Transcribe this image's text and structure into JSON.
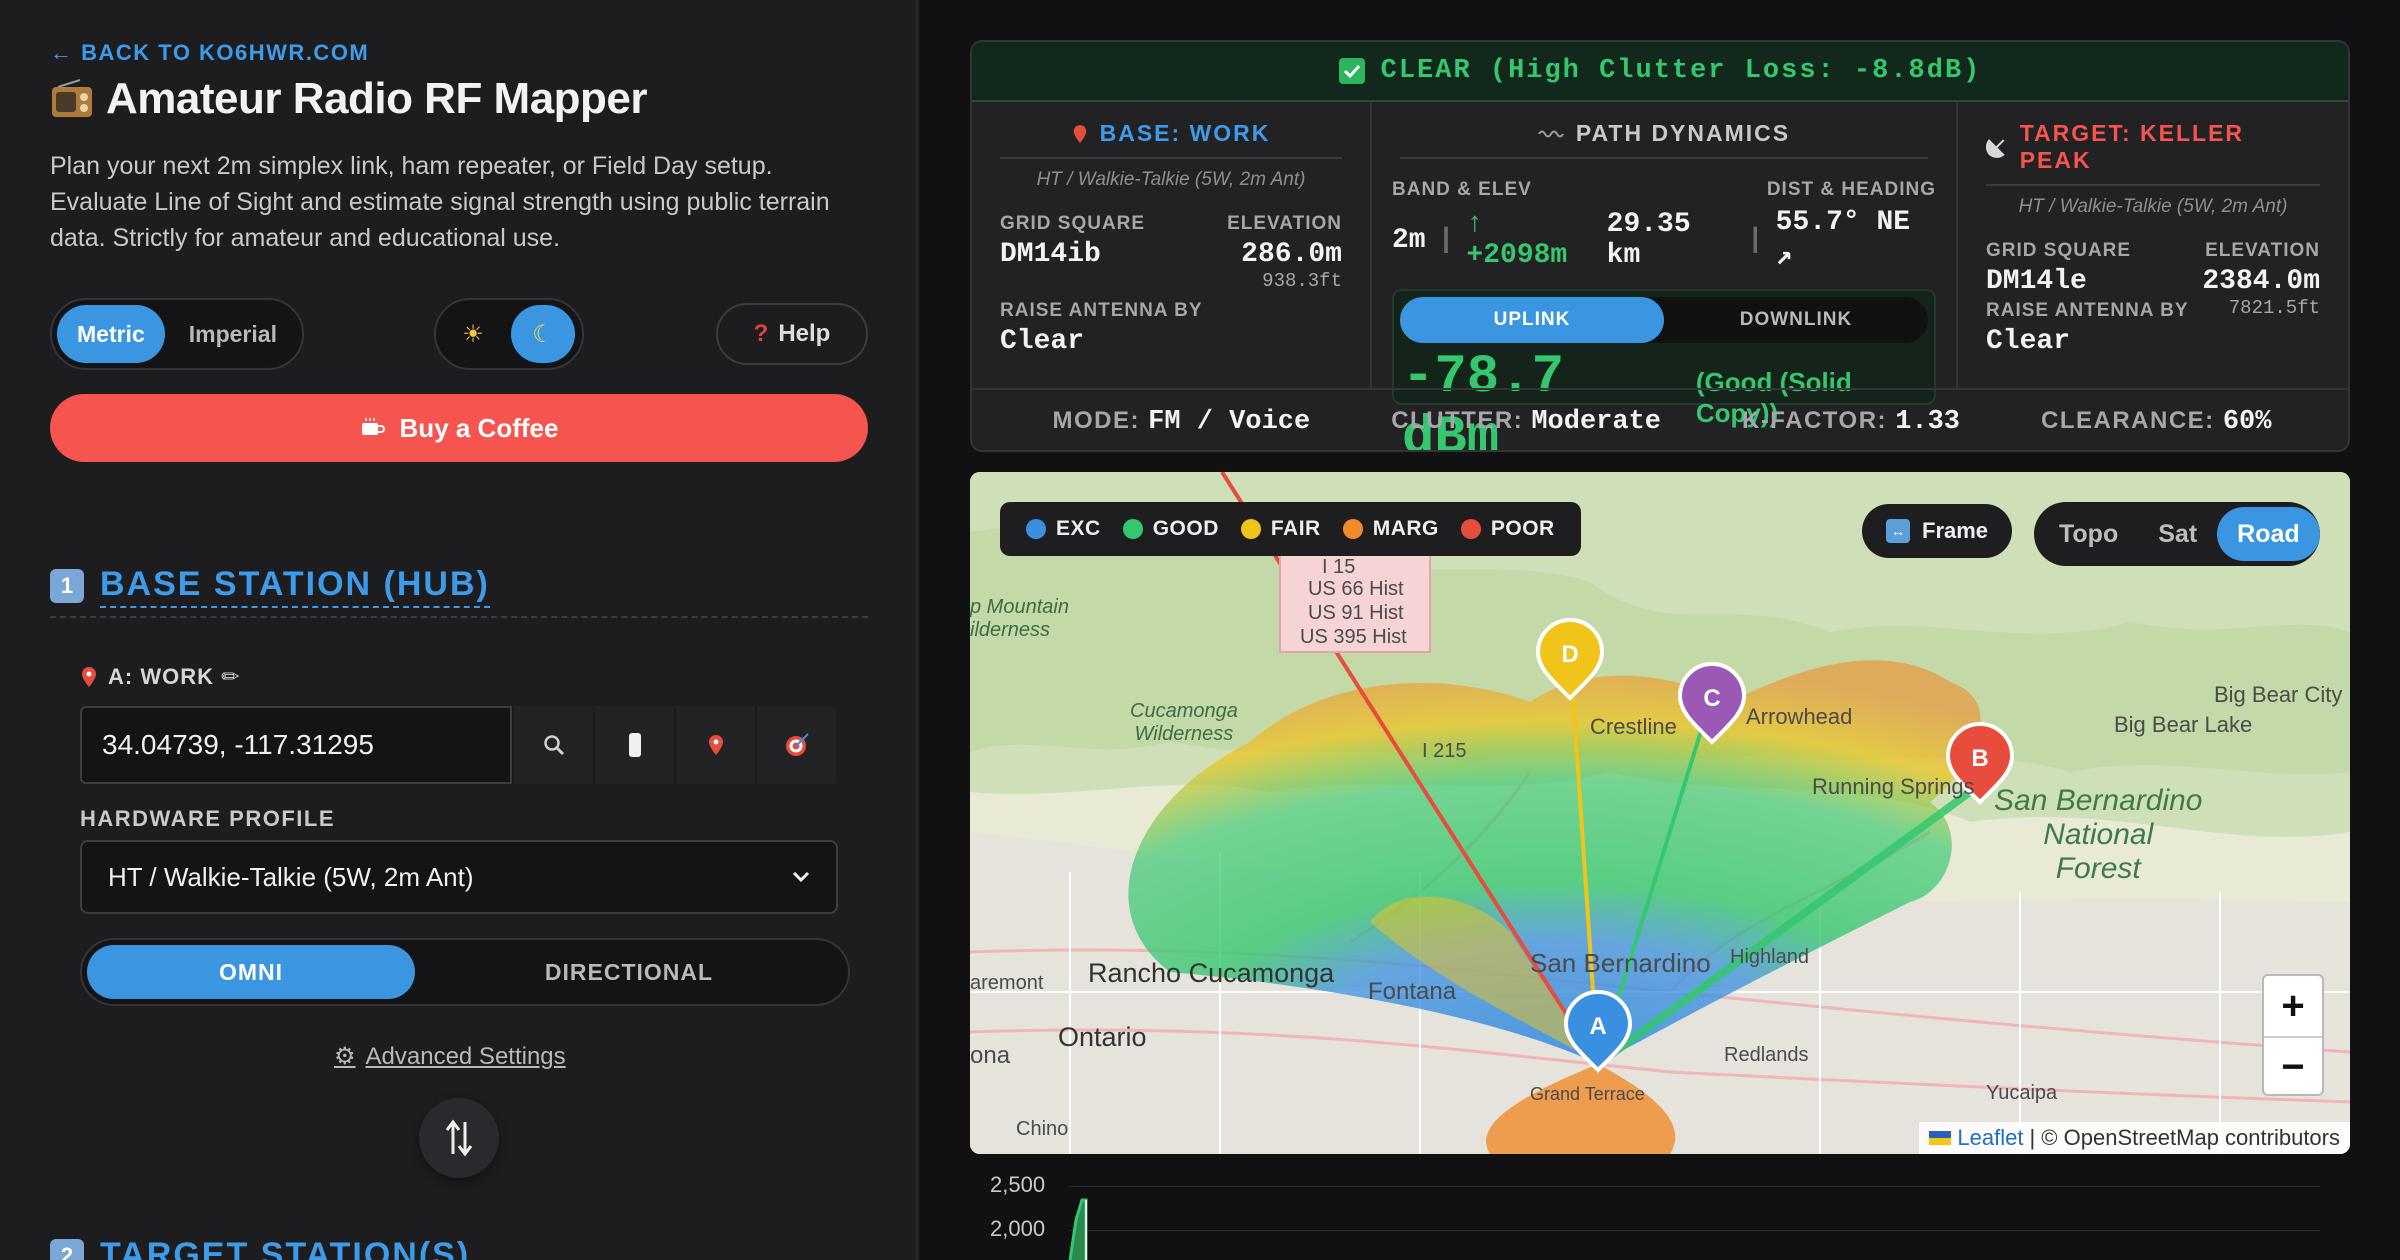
{
  "sidebar": {
    "back_link": "← BACK TO KO6HWR.COM",
    "title": "Amateur Radio RF Mapper",
    "intro": "Plan your next 2m simplex link, ham repeater, or Field Day setup. Evaluate Line of Sight and estimate signal strength using public terrain data. Strictly for amateur and educational use.",
    "units": {
      "metric": "Metric",
      "imperial": "Imperial",
      "selected": "Metric"
    },
    "theme": {
      "sun": "☀",
      "moon": "☾",
      "selected": "dark"
    },
    "help_label": "Help",
    "help_icon": "?",
    "coffee_label": "Buy a Coffee",
    "section1": {
      "number": "1",
      "label": "BASE STATION (HUB)"
    },
    "station_a": {
      "label": "A: WORK ✏",
      "coords": "34.04739, -117.31295",
      "hardware_label": "HARDWARE PROFILE",
      "hardware_value": "HT / Walkie-Talkie (5W, 2m Ant)",
      "mode_omni": "OMNI",
      "mode_directional": "DIRECTIONAL",
      "mode_selected": "OMNI"
    },
    "advanced_label": "Advanced Settings",
    "section2": {
      "number": "2",
      "label": "TARGET STATION(S)"
    }
  },
  "result": {
    "status": "CLEAR (High Clutter Loss: -8.8dB)",
    "base": {
      "header": "BASE: WORK",
      "profile": "HT / Walkie-Talkie (5W, 2m Ant)",
      "grid_label": "GRID SQUARE",
      "grid": "DM14ib",
      "elev_label": "ELEVATION",
      "elev": "286.0m",
      "elev_ft": "938.3ft",
      "raise_label": "RAISE ANTENNA BY",
      "raise": "Clear"
    },
    "path": {
      "header": "PATH DYNAMICS",
      "band_label": "BAND & ELEV",
      "dist_label": "DIST & HEADING",
      "band": "2m",
      "sep": "|",
      "elev_gain": "↑ +2098m",
      "dist": "29.35 km",
      "heading": "55.7° NE ↗",
      "uplink": "UPLINK",
      "downlink": "DOWNLINK",
      "link_selected": "UPLINK",
      "signal": "-78.7 dBm",
      "quality": "(Good (Solid Copy))"
    },
    "target": {
      "header": "TARGET: KELLER PEAK",
      "profile": "HT / Walkie-Talkie (5W, 2m Ant)",
      "grid_label": "GRID SQUARE",
      "grid": "DM14le",
      "elev_label": "ELEVATION",
      "elev": "2384.0m",
      "elev_ft": "7821.5ft",
      "raise_label": "RAISE ANTENNA BY",
      "raise": "Clear"
    },
    "footer": {
      "mode_label": "MODE:",
      "mode": "FM / Voice",
      "clutter_label": "CLUTTER:",
      "clutter": "Moderate",
      "k_label": "K-FACTOR:",
      "k": "1.33",
      "clear_label": "CLEARANCE:",
      "clearance": "60%"
    }
  },
  "map": {
    "legend": [
      {
        "label": "EXC",
        "color": "#3a8fe0"
      },
      {
        "label": "GOOD",
        "color": "#35c76e"
      },
      {
        "label": "FAIR",
        "color": "#f0c419"
      },
      {
        "label": "MARG",
        "color": "#f08a2a"
      },
      {
        "label": "POOR",
        "color": "#e84c3d"
      }
    ],
    "frame_label": "Frame",
    "layers": {
      "topo": "Topo",
      "sat": "Sat",
      "road": "Road",
      "selected": "Road"
    },
    "zoom_in": "+",
    "zoom_out": "−",
    "attribution_link": "Leaflet",
    "attribution_text": "| © OpenStreetMap contributors",
    "labels": {
      "i15": "I 15",
      "us66": "US 66 Hist",
      "us91": "US 91 Hist",
      "us395": "US 395 Hist",
      "mtn_wild": "p Mountain\nilderness",
      "cucamonga": "Cucamonga\nWilderness",
      "crestline": "Crestline",
      "arrowhead": "Arrowhead",
      "bigbearcity": "Big Bear City",
      "bigbearlake": "Big Bear Lake",
      "running": "Running Springs",
      "forest": "San Bernardino\nNational\nForest",
      "i215": "I 215",
      "rancho": "Rancho Cucamonga",
      "fontana": "Fontana",
      "sanbern": "San Bernardino",
      "highland": "Highland",
      "ontario": "Ontario",
      "claremont": "aremont",
      "ona": "ona",
      "redlands": "Redlands",
      "yucaipa": "Yucaipa",
      "chino": "Chino",
      "grandterrace": "Grand Terrace"
    },
    "markers": [
      {
        "id": "A",
        "color": "#3a8fe0"
      },
      {
        "id": "B",
        "color": "#e84c3d"
      },
      {
        "id": "C",
        "color": "#9b59b6"
      },
      {
        "id": "D",
        "color": "#f0c419"
      }
    ]
  },
  "profile": {
    "ticks": [
      "2,500",
      "2,000"
    ]
  }
}
